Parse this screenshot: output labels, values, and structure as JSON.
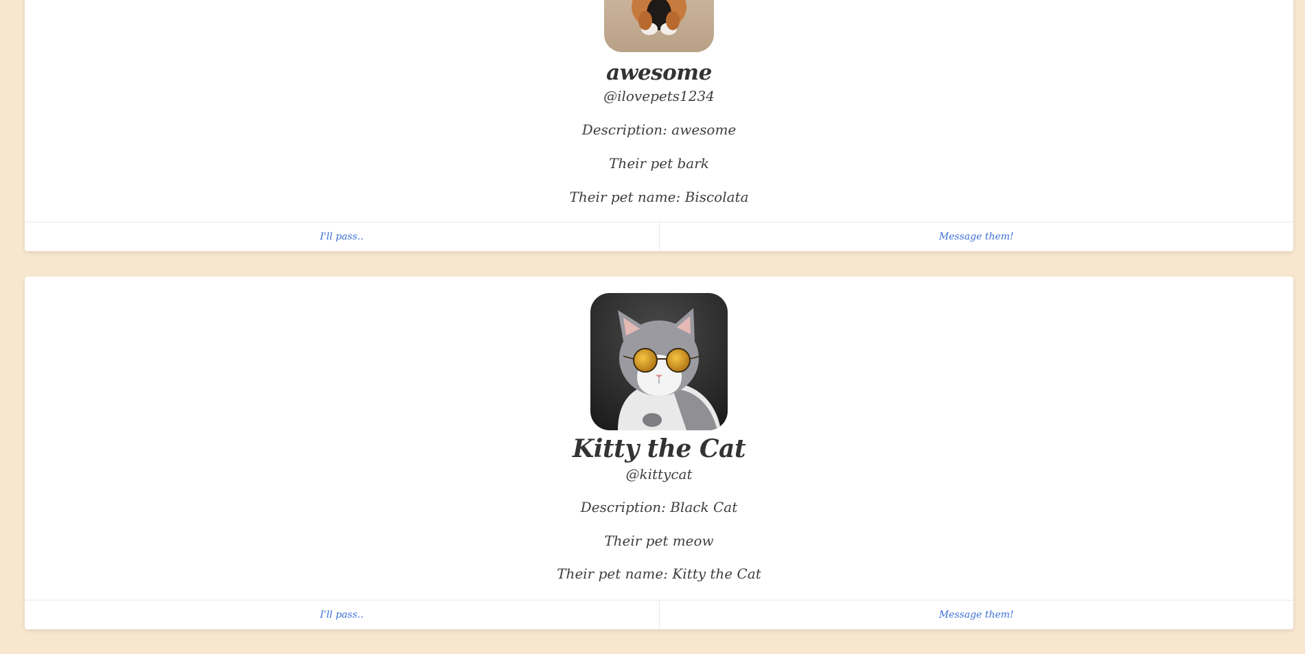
{
  "profiles": [
    {
      "name": "awesome",
      "handle": "@ilovepets1234",
      "description": "Description: awesome",
      "pet_sound": "Their pet bark",
      "pet_name": "Their pet name: Biscolata",
      "avatar_icon": "dog-photo",
      "pass_label": "I'll pass..",
      "message_label": "Message them!"
    },
    {
      "name": "Kitty the Cat",
      "handle": "@kittycat",
      "description": "Description: Black Cat",
      "pet_sound": "Their pet meow",
      "pet_name": "Their pet name: Kitty the Cat",
      "avatar_icon": "cat-with-sunglasses-photo",
      "pass_label": "I'll pass..",
      "message_label": "Message them!"
    }
  ],
  "colors": {
    "background": "#f7e7cf",
    "card": "#ffffff",
    "link": "#3b6fd6",
    "text": "#3a3a3a"
  }
}
